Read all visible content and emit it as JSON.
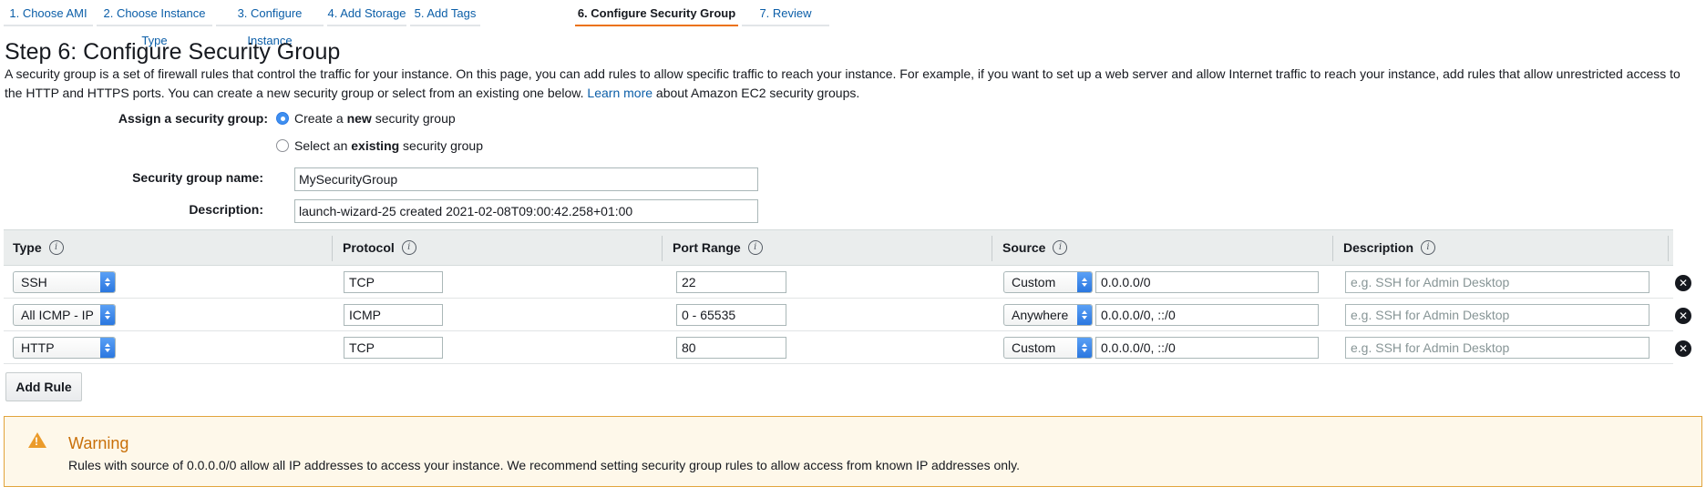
{
  "wizard": {
    "tabs": [
      {
        "label": "1. Choose AMI"
      },
      {
        "label": "2. Choose Instance Type"
      },
      {
        "label": "3. Configure Instance"
      },
      {
        "label": "4. Add Storage"
      },
      {
        "label": "5. Add Tags"
      },
      {
        "label": "6. Configure Security Group"
      },
      {
        "label": "7. Review"
      }
    ],
    "active_index": 5
  },
  "page": {
    "title": "Step 6: Configure Security Group",
    "intro_text": "A security group is a set of firewall rules that control the traffic for your instance. On this page, you can add rules to allow specific traffic to reach your instance. For example, if you want to set up a web server and allow Internet traffic to reach your instance, add rules that allow unrestricted access to the HTTP and HTTPS ports. You can create a new security group or select from an existing one below.",
    "learn_more": "Learn more",
    "intro_suffix": "about Amazon EC2 security groups."
  },
  "assign": {
    "label": "Assign a security group:",
    "option_new": {
      "pre": "Create a ",
      "bold": "new",
      "post": " security group",
      "selected": true
    },
    "option_existing": {
      "pre": "Select an ",
      "bold": "existing",
      "post": " security group",
      "selected": false
    }
  },
  "group_name": {
    "label": "Security group name:",
    "value": "MySecurityGroup"
  },
  "description": {
    "label": "Description:",
    "value": "launch-wizard-25 created 2021-02-08T09:00:42.258+01:00"
  },
  "table": {
    "headers": {
      "type": "Type",
      "protocol": "Protocol",
      "port_range": "Port Range",
      "source": "Source",
      "description": "Description"
    },
    "info_glyph": "i",
    "rows": [
      {
        "type": "SSH",
        "protocol": "TCP",
        "port": "22",
        "source_mode": "Custom",
        "source_cidr": "0.0.0.0/0",
        "description_placeholder": "e.g. SSH for Admin Desktop"
      },
      {
        "type": "All ICMP - IP",
        "protocol": "ICMP",
        "port": "0 - 65535",
        "source_mode": "Anywhere",
        "source_cidr": "0.0.0.0/0, ::/0",
        "description_placeholder": "e.g. SSH for Admin Desktop"
      },
      {
        "type": "HTTP",
        "protocol": "TCP",
        "port": "80",
        "source_mode": "Custom",
        "source_cidr": "0.0.0.0/0, ::/0",
        "description_placeholder": "e.g. SSH for Admin Desktop"
      }
    ],
    "remove_glyph": "✕"
  },
  "add_rule_label": "Add Rule",
  "warning": {
    "title": "Warning",
    "text": "Rules with source of 0.0.0.0/0 allow all IP addresses to access your instance. We recommend setting security group rules to allow access from known IP addresses only.",
    "color": "#c9700a"
  }
}
